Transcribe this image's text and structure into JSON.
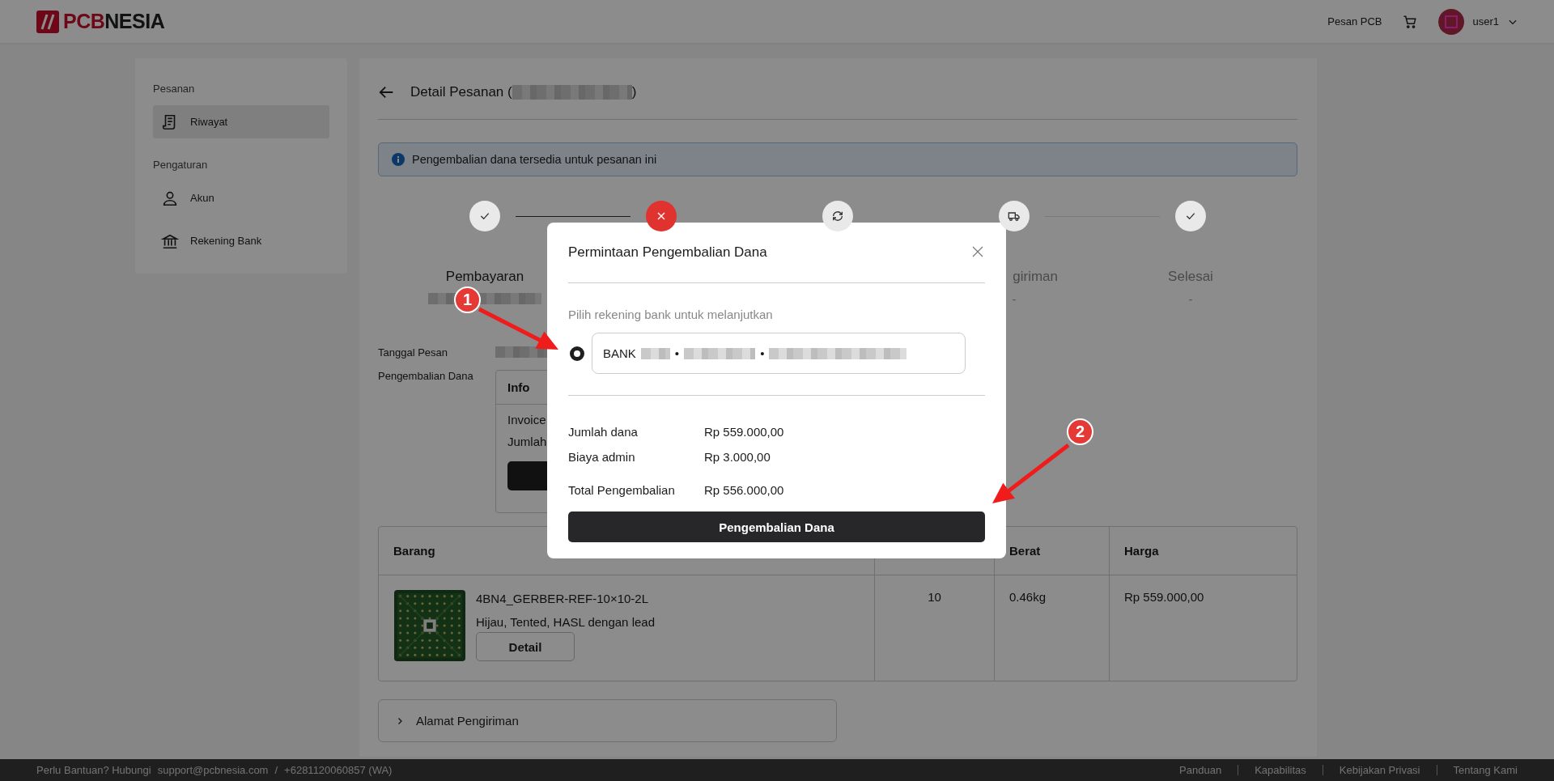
{
  "header": {
    "brand_strong": "PCB",
    "brand_rest": "NESIA",
    "nav_link": "Pesan PCB",
    "user_name": "user1"
  },
  "sidebar": {
    "sections": [
      {
        "title": "Pesanan",
        "items": [
          {
            "label": "Riwayat",
            "selected": true
          }
        ]
      },
      {
        "title": "Pengaturan",
        "items": [
          {
            "label": "Akun",
            "selected": false
          },
          {
            "label": "Rekening Bank",
            "selected": false
          }
        ]
      }
    ]
  },
  "page": {
    "title": "Detail Pesanan (",
    "title_end": ")",
    "order_id_redacted": true
  },
  "alert": {
    "text": "Pengembalian dana tersedia untuk pesanan ini"
  },
  "steps": [
    {
      "kind": "done",
      "connector": true,
      "label": "Pembayaran",
      "sub_redacted": true
    },
    {
      "kind": "cancelled",
      "connector": false
    },
    {
      "kind": "processing",
      "connector": false
    },
    {
      "kind": "shipping",
      "connector": true,
      "label": "giriman",
      "cut": true,
      "sub": "-"
    },
    {
      "kind": "done",
      "connector": false,
      "label": "Selesai",
      "sub": "-"
    }
  ],
  "details": {
    "order_date_label": "Tanggal Pesan",
    "refund_label": "Pengembalian Dana",
    "info_title": "Info",
    "info_rows": [
      "Invoice",
      "Jumlah"
    ]
  },
  "table": {
    "columns": [
      "Barang",
      "",
      "Berat",
      "Harga"
    ],
    "rows": [
      {
        "name": "4BN4_GERBER-REF-10×10-2L",
        "spec": "Hijau, Tented, HASL dengan lead",
        "detail_button": "Detail",
        "qty": "10",
        "weight": "0.46kg",
        "price": "Rp 559.000,00"
      }
    ]
  },
  "address": {
    "label": "Alamat Pengiriman",
    "expanded": false
  },
  "footer": {
    "help": "Perlu Bantuan? Hubungi",
    "email": "support@pcbnesia.com",
    "separator": "/",
    "phone": "+6281120060857 (WA)",
    "links": [
      "Panduan",
      "Kapabilitas",
      "Kebijakan Privasi",
      "Tentang Kami"
    ]
  },
  "modal": {
    "title": "Permintaan Pengembalian Dana",
    "prompt": "Pilih rekening bank untuk melanjutkan",
    "bank_option": {
      "prefix": "BANK",
      "separator": "•",
      "selected": true
    },
    "summary": [
      {
        "label": "Jumlah dana",
        "value": "Rp 559.000,00",
        "kind": "normal"
      },
      {
        "label": "Biaya admin",
        "value": "Rp 3.000,00",
        "kind": "normal"
      },
      {
        "label": "Total Pengembalian",
        "value": "Rp 556.000,00",
        "kind": "total"
      }
    ],
    "submit": "Pengembalian Dana"
  },
  "annotations": [
    {
      "label": "1"
    },
    {
      "label": "2"
    }
  ]
}
